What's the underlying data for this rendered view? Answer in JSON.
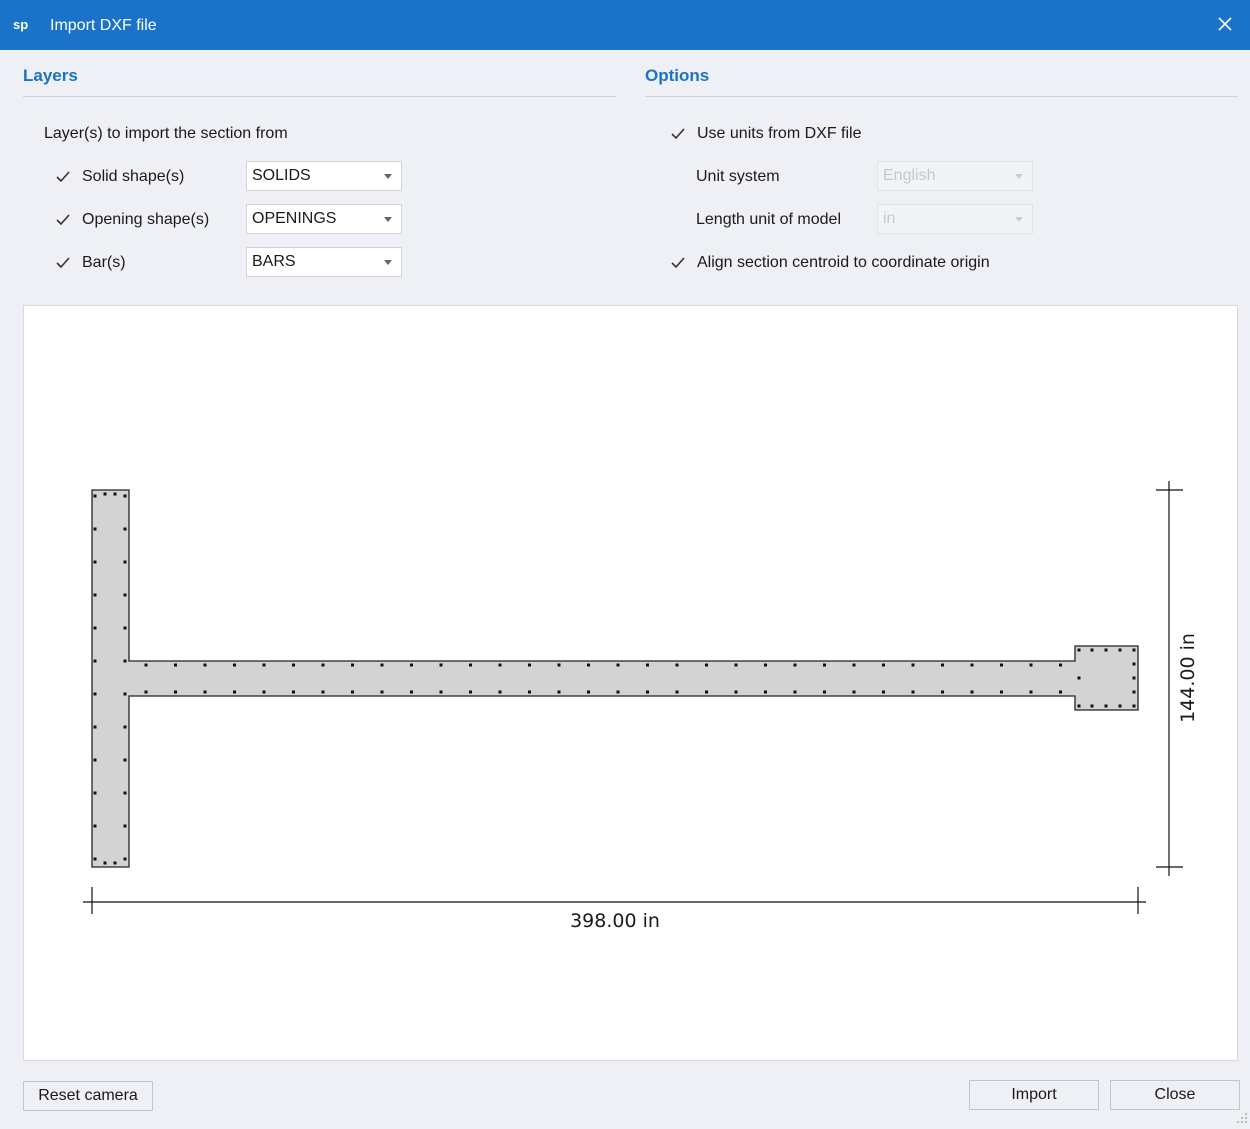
{
  "window": {
    "app_logo": "sp",
    "title": "Import DXF file"
  },
  "layers": {
    "heading": "Layers",
    "intro": "Layer(s) to import the section from",
    "rows": [
      {
        "label": "Solid shape(s)",
        "checked": true,
        "value": "SOLIDS"
      },
      {
        "label": "Opening shape(s)",
        "checked": true,
        "value": "OPENINGS"
      },
      {
        "label": "Bar(s)",
        "checked": true,
        "value": "BARS"
      }
    ]
  },
  "options": {
    "heading": "Options",
    "use_units_label": "Use units from DXF file",
    "use_units_checked": true,
    "unit_system_label": "Unit system",
    "unit_system_value": "English",
    "length_unit_label": "Length unit of model",
    "length_unit_value": "in",
    "align_label": "Align section centroid to coordinate origin",
    "align_checked": true
  },
  "preview": {
    "width_dimension": "398.00 in",
    "height_dimension": "144.00 in",
    "section_fill": "#d3d3d3"
  },
  "buttons": {
    "reset_camera": "Reset camera",
    "import": "Import",
    "close": "Close"
  },
  "colors": {
    "accent": "#1a73c8",
    "background": "#eef0f5"
  }
}
